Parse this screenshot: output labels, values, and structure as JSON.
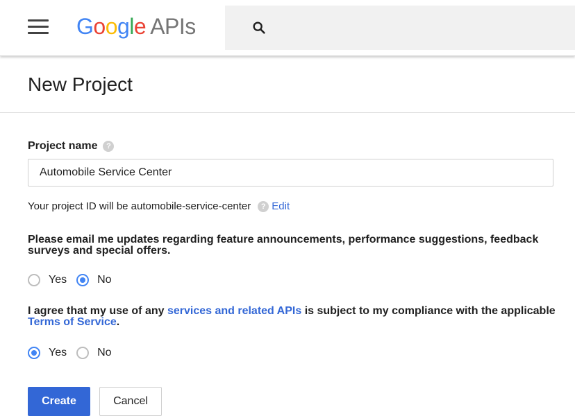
{
  "header": {
    "logo": {
      "g": "G",
      "o1": "o",
      "o2": "o",
      "g2": "g",
      "l": "l",
      "e": "e",
      "suffix": "APIs"
    },
    "search": {
      "value": ""
    }
  },
  "page": {
    "title": "New Project"
  },
  "form": {
    "project_name_label": "Project name",
    "project_name_value": "Automobile Service Center",
    "project_id_text": "Your project ID will be automobile-service-center",
    "edit_label": "Edit",
    "email_question": "Please email me updates regarding feature announcements, performance suggestions, feedback surveys and special offers.",
    "email_options": [
      {
        "label": "Yes",
        "checked": false
      },
      {
        "label": "No",
        "checked": true
      }
    ],
    "terms_prefix": "I agree that my use of any ",
    "terms_link1": "services and related APIs",
    "terms_middle": " is subject to my compliance with the applicable ",
    "terms_link2": "Terms of Service",
    "terms_suffix": ".",
    "terms_options": [
      {
        "label": "Yes",
        "checked": true
      },
      {
        "label": "No",
        "checked": false
      }
    ],
    "create_label": "Create",
    "cancel_label": "Cancel"
  },
  "icons": {
    "menu": "hamburger-menu-icon",
    "search": "search-icon",
    "help": "help-circle-icon"
  },
  "colors": {
    "accent": "#3367d6",
    "radio_checked": "#4285f4",
    "google_blue": "#4285f4",
    "google_red": "#ea4335",
    "google_yellow": "#fbbc05",
    "google_green": "#34a853"
  }
}
